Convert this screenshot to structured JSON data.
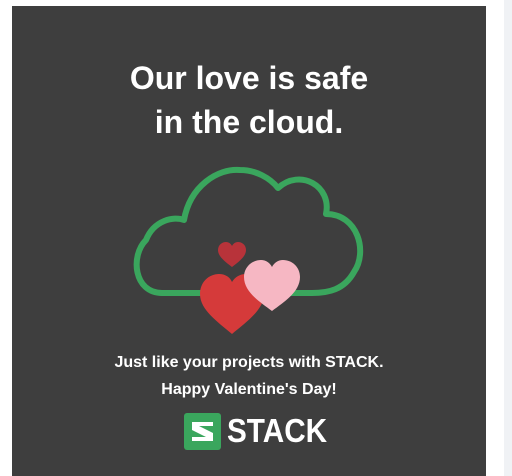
{
  "headline": {
    "line1": "Our love is safe",
    "line2": "in the cloud."
  },
  "tagline": {
    "line1": "Just like your projects with STACK.",
    "line2": "Happy Valentine's Day!"
  },
  "brand": {
    "name": "STACK",
    "logo_icon": "stack-logo-icon"
  },
  "art": {
    "cloud_icon": "cloud-icon",
    "hearts": [
      "heart-icon-red",
      "heart-icon-pink",
      "heart-icon-small"
    ]
  },
  "colors": {
    "background": "#3e3e3e",
    "cloud_stroke": "#3aa65d",
    "heart_red": "#d53a3a",
    "heart_pink": "#f6b7c3",
    "heart_small": "#b8333a",
    "logo_green": "#3aa65d"
  }
}
